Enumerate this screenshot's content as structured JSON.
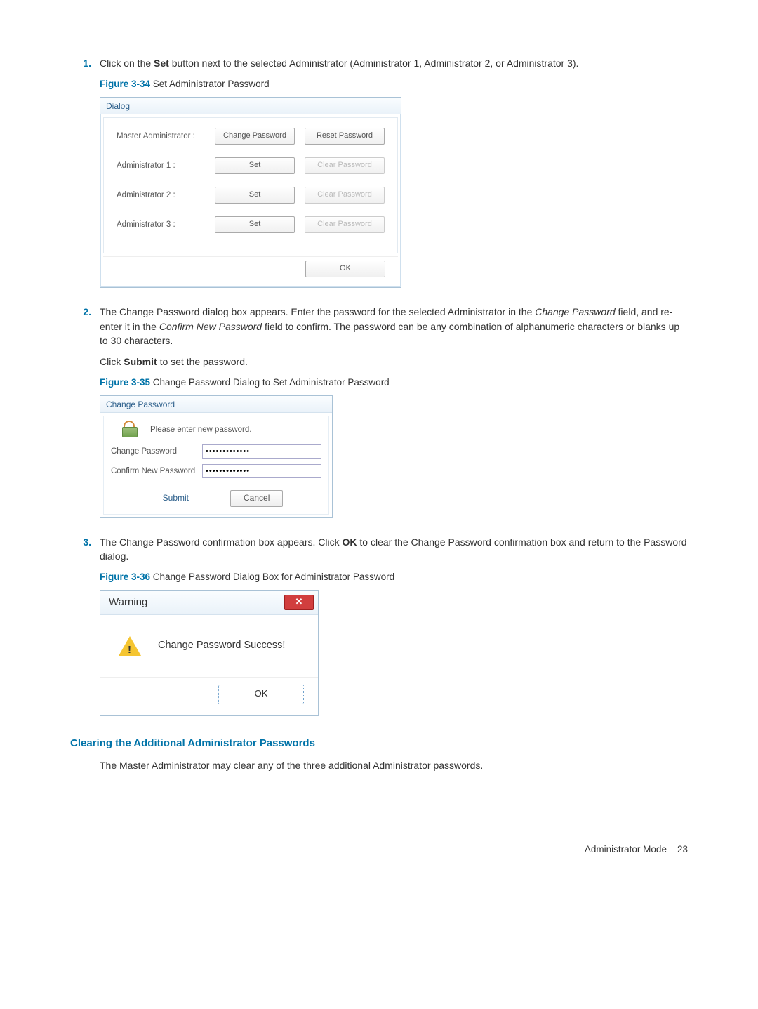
{
  "steps": {
    "s1": {
      "num": "1.",
      "text_a": "Click on the ",
      "bold_a": "Set",
      "text_b": " button next to the selected Administrator (Administrator 1, Administrator 2, or Administrator 3)."
    },
    "s2": {
      "num": "2.",
      "text_a": "The Change Password dialog box appears. Enter the password for the selected Administrator in the ",
      "ital_a": "Change Password",
      "text_b": " field, and re-enter it in the ",
      "ital_b": "Confirm New Password",
      "text_c": " field to confirm. The password can be any combination of alphanumeric characters or blanks up to 30 characters.",
      "sub_a": "Click ",
      "sub_bold": "Submit",
      "sub_b": " to set the password."
    },
    "s3": {
      "num": "3.",
      "text_a": "The Change Password confirmation box appears. Click ",
      "bold_a": "OK",
      "text_b": " to clear the Change Password confirmation box and return to the Password dialog."
    }
  },
  "figures": {
    "f34": {
      "label": "Figure 3-34",
      "caption": "  Set Administrator Password"
    },
    "f35": {
      "label": "Figure 3-35",
      "caption": "  Change Password Dialog to Set Administrator Password"
    },
    "f36": {
      "label": "Figure 3-36",
      "caption": "  Change Password Dialog Box for Administrator Password"
    }
  },
  "dialog34": {
    "title": "Dialog",
    "rows": [
      {
        "label": "Master Administrator :",
        "b1": "Change Password",
        "b2": "Reset Password",
        "b2_disabled": false
      },
      {
        "label": "Administrator 1 :",
        "b1": "Set",
        "b2": "Clear Password",
        "b2_disabled": true
      },
      {
        "label": "Administrator 2 :",
        "b1": "Set",
        "b2": "Clear Password",
        "b2_disabled": true
      },
      {
        "label": "Administrator 3 :",
        "b1": "Set",
        "b2": "Clear Password",
        "b2_disabled": true
      }
    ],
    "ok": "OK"
  },
  "dialog35": {
    "title": "Change Password",
    "msg": "Please enter new password.",
    "row1": "Change Password",
    "row2": "Confirm New Password",
    "val1": "•••••••••••••",
    "val2": "•••••••••••••",
    "submit": "Submit",
    "cancel": "Cancel"
  },
  "dialog36": {
    "title": "Warning",
    "msg": "Change Password Success!",
    "ok": "OK"
  },
  "section": {
    "heading": "Clearing the Additional Administrator Passwords",
    "para": "The Master Administrator may clear any of the three additional Administrator passwords."
  },
  "footer": {
    "section": "Administrator Mode",
    "page": "23"
  }
}
